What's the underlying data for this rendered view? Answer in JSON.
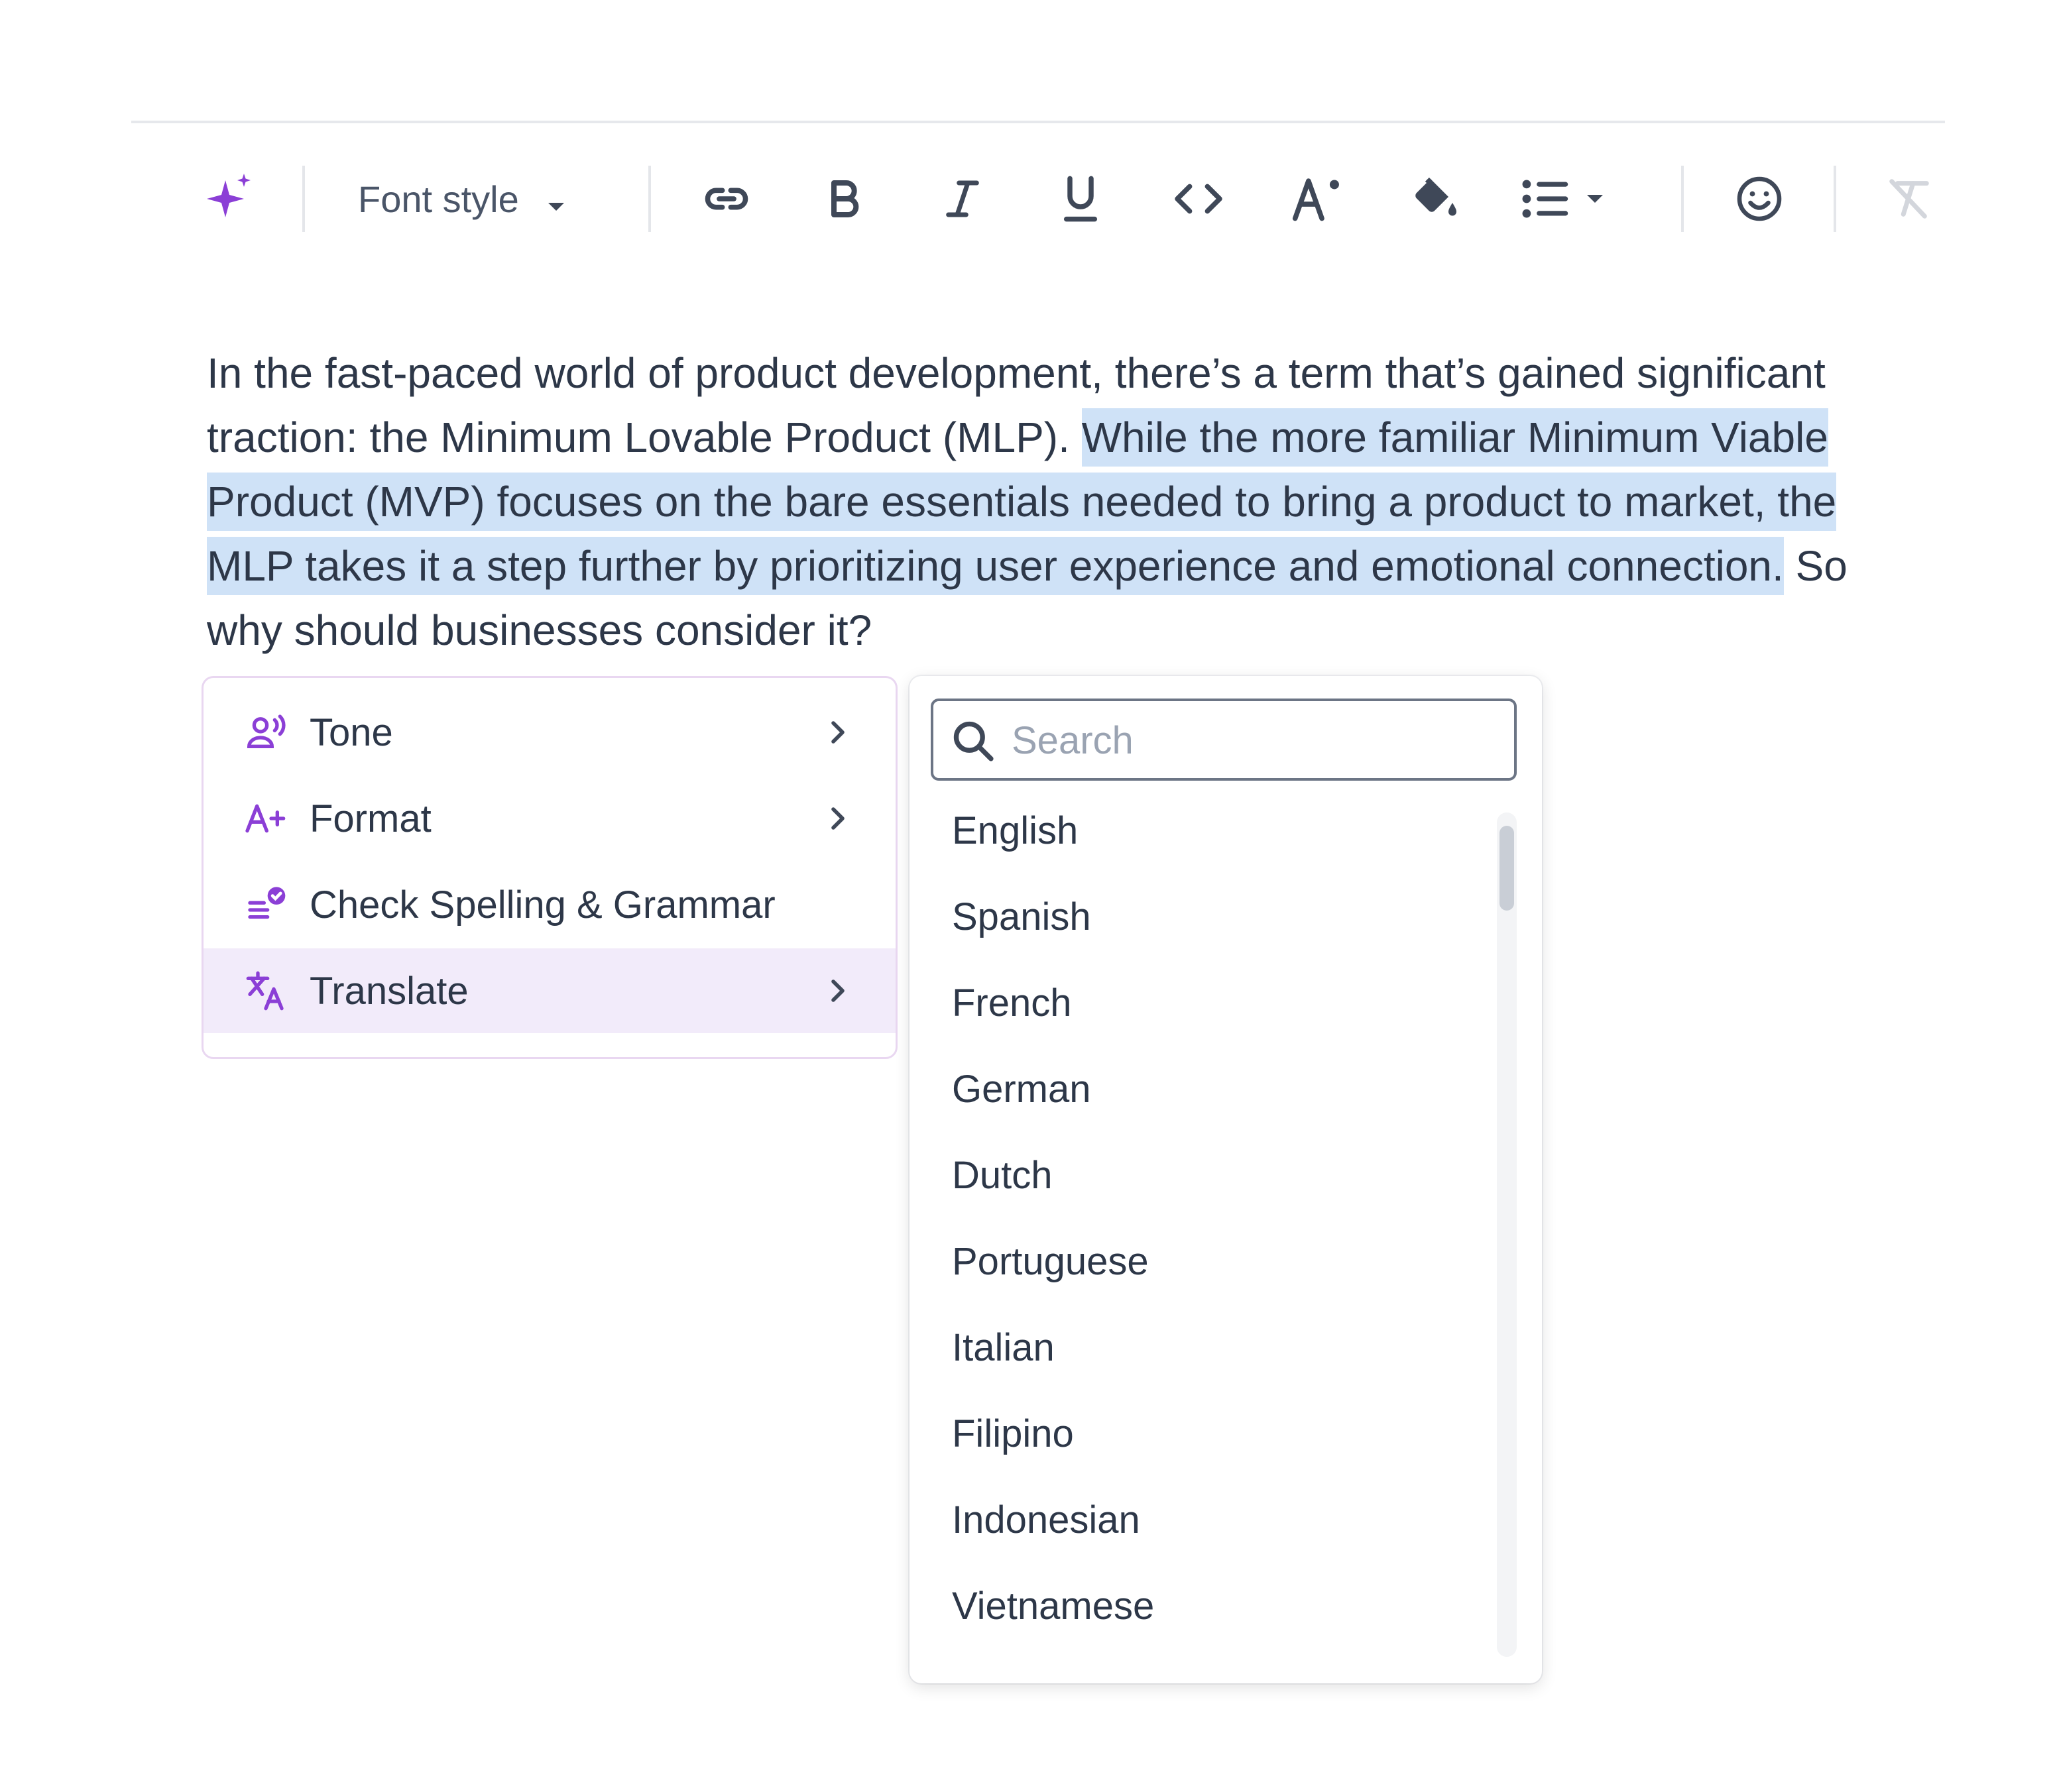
{
  "toolbar": {
    "ai_icon": "sparkle-icon",
    "font_style_label": "Font style",
    "buttons": [
      "link-icon",
      "bold-icon",
      "italic-icon",
      "underline-icon",
      "code-icon",
      "superscript-icon",
      "fill-color-icon",
      "bullet-list-icon",
      "emoji-icon",
      "clear-format-icon"
    ]
  },
  "paragraph": {
    "before": "In the fast-paced world of product development, there’s a term that’s gained significant traction: the Minimum Lovable Product (MLP). ",
    "selected": "While the more familiar Minimum Viable Product (MVP) focuses on the bare essentials needed to bring a product to market, the MLP takes it a step further by prioritizing user experience and emotional connection.",
    "after": " So why should businesses consider it?"
  },
  "ai_menu": {
    "items": [
      {
        "label": "Tone",
        "icon": "tone-icon",
        "has_submenu": true
      },
      {
        "label": "Format",
        "icon": "format-icon",
        "has_submenu": true
      },
      {
        "label": "Check Spelling & Grammar",
        "icon": "spellcheck-icon",
        "has_submenu": false
      },
      {
        "label": "Translate",
        "icon": "translate-icon",
        "has_submenu": true,
        "active": true
      }
    ]
  },
  "language_panel": {
    "search_placeholder": "Search",
    "languages": [
      "English",
      "Spanish",
      "French",
      "German",
      "Dutch",
      "Portuguese",
      "Italian",
      "Filipino",
      "Indonesian",
      "Vietnamese"
    ]
  },
  "colors": {
    "accent": "#8b3fd6",
    "selection": "#cfe2f7",
    "active_menu_bg": "#f2ebfa",
    "text": "#2d3748",
    "icon": "#3f4858"
  }
}
